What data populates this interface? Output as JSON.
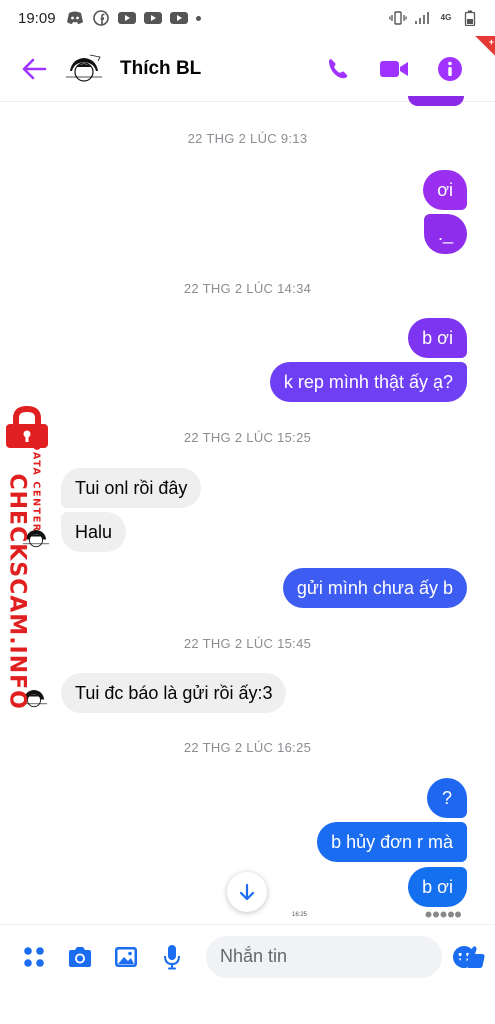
{
  "status_bar": {
    "time": "19:09",
    "left_icons": [
      "discord-icon",
      "facebook-icon",
      "youtube-icon",
      "youtube-icon",
      "youtube-icon",
      "dot-icon"
    ],
    "right_icons": [
      "vibrate-icon",
      "signal-icon",
      "network-4g-icon",
      "battery-icon"
    ],
    "network_label": "4G"
  },
  "header": {
    "contact_name": "Thích BL",
    "actions": [
      "phone-icon",
      "video-icon",
      "info-icon"
    ]
  },
  "colors": {
    "accent": "#a033ff",
    "purple_bubble": "#8a2ae6",
    "violet_bubble": "#6e3ff5",
    "blue_bubble": "#1a6cf0",
    "incoming_bubble": "#efefef",
    "timestamp": "#8a8d91",
    "watermark": "#e02020"
  },
  "messages": [
    {
      "type": "timestamp",
      "text": "22 THG 2 LÚC 9:13"
    },
    {
      "type": "outgoing",
      "text": "ơi",
      "color": "#9b2ff0"
    },
    {
      "type": "outgoing",
      "text": "._",
      "color": "#8f2ded"
    },
    {
      "type": "timestamp",
      "text": "22 THG 2 LÚC 14:34"
    },
    {
      "type": "outgoing",
      "text": "b ơi",
      "color": "#7e35f2"
    },
    {
      "type": "outgoing",
      "text": "k rep mình thật ấy ạ?",
      "color": "#6e3ff5"
    },
    {
      "type": "timestamp",
      "text": "22 THG 2 LÚC 15:25"
    },
    {
      "type": "incoming",
      "text": "Tui onl rồi đây"
    },
    {
      "type": "incoming",
      "text": "Halu"
    },
    {
      "type": "outgoing",
      "text": "gửi mình chưa ấy b",
      "color": "#3d5cf2"
    },
    {
      "type": "timestamp",
      "text": "22 THG 2 LÚC 15:45"
    },
    {
      "type": "incoming",
      "text": "Tui đc báo là gửi rồi ấy:3"
    },
    {
      "type": "timestamp",
      "text": "22 THG 2 LÚC 16:25"
    },
    {
      "type": "outgoing",
      "text": "?",
      "color": "#1f66f0"
    },
    {
      "type": "outgoing",
      "text": "b hủy đơn r mà",
      "color": "#1a6cf0"
    },
    {
      "type": "outgoing",
      "text": "b ơi",
      "color": "#1570f0"
    }
  ],
  "seen_row": {
    "time": "16:25"
  },
  "watermark": {
    "main": "CHECKSCAM.INFO",
    "sub": "DATA CENTER"
  },
  "composer": {
    "placeholder": "Nhắn tin",
    "buttons": [
      "apps-icon",
      "camera-icon",
      "gallery-icon",
      "mic-icon"
    ],
    "emoji": "emoji-icon",
    "like": "thumbs-up-icon"
  }
}
